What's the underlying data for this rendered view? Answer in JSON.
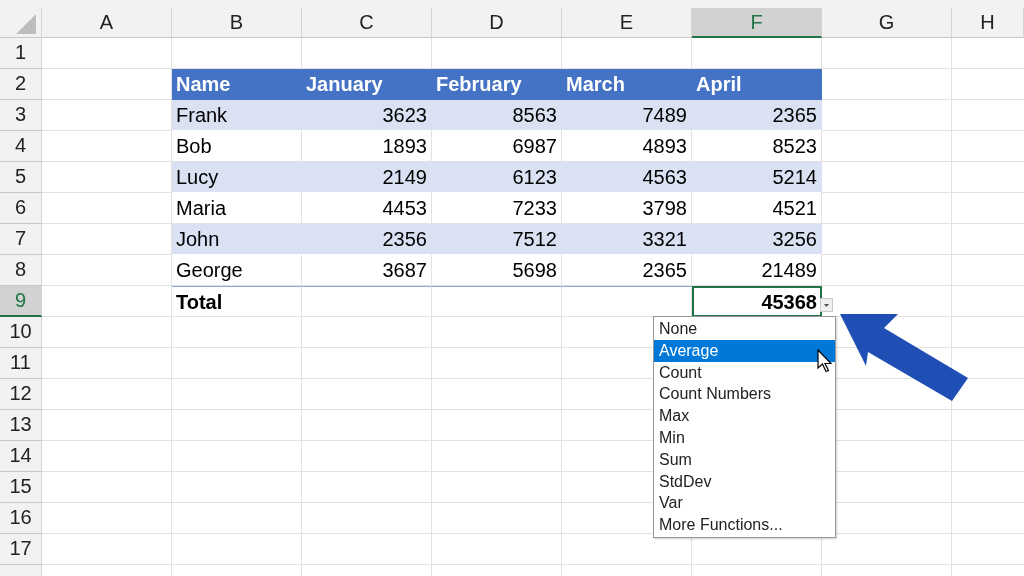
{
  "columns": [
    {
      "label": "A",
      "selected": false
    },
    {
      "label": "B",
      "selected": false
    },
    {
      "label": "C",
      "selected": false
    },
    {
      "label": "D",
      "selected": false
    },
    {
      "label": "E",
      "selected": false
    },
    {
      "label": "F",
      "selected": true
    },
    {
      "label": "G",
      "selected": false
    },
    {
      "label": "H",
      "selected": false
    }
  ],
  "rows": [
    {
      "label": "1",
      "selected": false
    },
    {
      "label": "2",
      "selected": false
    },
    {
      "label": "3",
      "selected": false
    },
    {
      "label": "4",
      "selected": false
    },
    {
      "label": "5",
      "selected": false
    },
    {
      "label": "6",
      "selected": false
    },
    {
      "label": "7",
      "selected": false
    },
    {
      "label": "8",
      "selected": false
    },
    {
      "label": "9",
      "selected": true
    },
    {
      "label": "10",
      "selected": false
    },
    {
      "label": "11",
      "selected": false
    },
    {
      "label": "12",
      "selected": false
    },
    {
      "label": "13",
      "selected": false
    },
    {
      "label": "14",
      "selected": false
    },
    {
      "label": "15",
      "selected": false
    },
    {
      "label": "16",
      "selected": false
    },
    {
      "label": "17",
      "selected": false
    }
  ],
  "table": {
    "columns": [
      "Name",
      "January",
      "February",
      "March",
      "April"
    ],
    "rows": [
      [
        "Frank",
        "3623",
        "8563",
        "7489",
        "2365"
      ],
      [
        "Bob",
        "1893",
        "6987",
        "4893",
        "8523"
      ],
      [
        "Lucy",
        "2149",
        "6123",
        "4563",
        "5214"
      ],
      [
        "Maria",
        "4453",
        "7233",
        "3798",
        "4521"
      ],
      [
        "John",
        "2356",
        "7512",
        "3321",
        "3256"
      ],
      [
        "George",
        "3687",
        "5698",
        "2365",
        "21489"
      ]
    ],
    "total": {
      "label": "Total",
      "value": "45368"
    }
  },
  "total_dropdown": {
    "items": [
      {
        "label": "None",
        "selected": false
      },
      {
        "label": "Average",
        "selected": true
      },
      {
        "label": "Count",
        "selected": false
      },
      {
        "label": "Count Numbers",
        "selected": false
      },
      {
        "label": "Max",
        "selected": false
      },
      {
        "label": "Min",
        "selected": false
      },
      {
        "label": "Sum",
        "selected": false
      },
      {
        "label": "StdDev",
        "selected": false
      },
      {
        "label": "Var",
        "selected": false
      },
      {
        "label": "More Functions...",
        "selected": false
      }
    ]
  }
}
